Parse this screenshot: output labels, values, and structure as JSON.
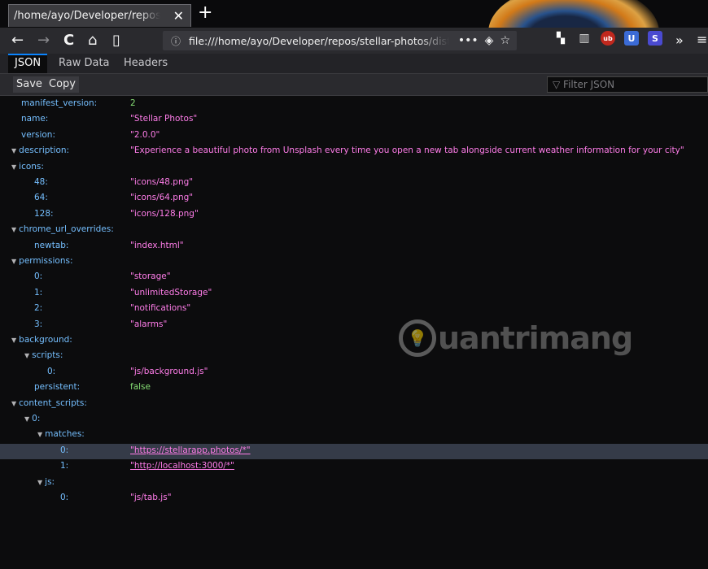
{
  "browser": {
    "tab": {
      "title": "/home/ayo/Developer/repos/stellar-photos/dist/manifest.json",
      "close": "✕"
    },
    "new_tab": "+",
    "nav": {
      "back": "←",
      "forward": "→",
      "reload": "C",
      "home": "⌂",
      "reader": "▯"
    },
    "url": {
      "info": "ⓘ",
      "text": "file:///home/ayo/Developer/repos/stellar-photos/dist/manifest.json",
      "more": "•••",
      "pocket": "◈",
      "star": "☆"
    },
    "extensions": [
      {
        "name": "library",
        "label": "▥"
      },
      {
        "name": "ublock",
        "label": "ub"
      },
      {
        "name": "shield",
        "label": "U"
      },
      {
        "name": "s-ext",
        "label": "S"
      }
    ],
    "overflow": "»",
    "menu": "≡"
  },
  "viewer": {
    "tabs": [
      "JSON",
      "Raw Data",
      "Headers"
    ],
    "toolbar": {
      "save": "Save",
      "copy": "Copy",
      "filter_placeholder": "▽ Filter JSON"
    }
  },
  "json_rows": [
    {
      "key": "manifest_version:",
      "value": "2",
      "type": "num",
      "indent": 0,
      "twisty": false
    },
    {
      "key": "name:",
      "value": "\"Stellar Photos\"",
      "type": "str",
      "indent": 0,
      "twisty": false
    },
    {
      "key": "version:",
      "value": "\"2.0.0\"",
      "type": "str",
      "indent": 0,
      "twisty": false
    },
    {
      "key": "description:",
      "value": "\"Experience a beautiful photo from Unsplash every time you open a new tab alongside current weather information for your city\"",
      "type": "str",
      "indent": 0,
      "twisty": true
    },
    {
      "key": "icons:",
      "value": "",
      "type": "obj",
      "indent": 0,
      "twisty": true
    },
    {
      "key": "48:",
      "value": "\"icons/48.png\"",
      "type": "str",
      "indent": 1,
      "twisty": false
    },
    {
      "key": "64:",
      "value": "\"icons/64.png\"",
      "type": "str",
      "indent": 1,
      "twisty": false
    },
    {
      "key": "128:",
      "value": "\"icons/128.png\"",
      "type": "str",
      "indent": 1,
      "twisty": false
    },
    {
      "key": "chrome_url_overrides:",
      "value": "",
      "type": "obj",
      "indent": 0,
      "twisty": true
    },
    {
      "key": "newtab:",
      "value": "\"index.html\"",
      "type": "str",
      "indent": 1,
      "twisty": false
    },
    {
      "key": "permissions:",
      "value": "",
      "type": "obj",
      "indent": 0,
      "twisty": true
    },
    {
      "key": "0:",
      "value": "\"storage\"",
      "type": "str",
      "indent": 1,
      "twisty": false
    },
    {
      "key": "1:",
      "value": "\"unlimitedStorage\"",
      "type": "str",
      "indent": 1,
      "twisty": false
    },
    {
      "key": "2:",
      "value": "\"notifications\"",
      "type": "str",
      "indent": 1,
      "twisty": false
    },
    {
      "key": "3:",
      "value": "\"alarms\"",
      "type": "str",
      "indent": 1,
      "twisty": false
    },
    {
      "key": "background:",
      "value": "",
      "type": "obj",
      "indent": 0,
      "twisty": true
    },
    {
      "key": "scripts:",
      "value": "",
      "type": "obj",
      "indent": 1,
      "twisty": true
    },
    {
      "key": "0:",
      "value": "\"js/background.js\"",
      "type": "str",
      "indent": 2,
      "twisty": false
    },
    {
      "key": "persistent:",
      "value": "false",
      "type": "bool",
      "indent": 1,
      "twisty": false
    },
    {
      "key": "content_scripts:",
      "value": "",
      "type": "obj",
      "indent": 0,
      "twisty": true
    },
    {
      "key": "0:",
      "value": "",
      "type": "obj",
      "indent": 1,
      "twisty": true
    },
    {
      "key": "matches:",
      "value": "",
      "type": "obj",
      "indent": 2,
      "twisty": true
    },
    {
      "key": "0:",
      "value": "\"https://stellarapp.photos/*\"",
      "type": "link",
      "indent": 3,
      "twisty": false,
      "selected": true
    },
    {
      "key": "1:",
      "value": "\"http://localhost:3000/*\"",
      "type": "link",
      "indent": 3,
      "twisty": false
    },
    {
      "key": "js:",
      "value": "",
      "type": "obj",
      "indent": 2,
      "twisty": true
    },
    {
      "key": "0:",
      "value": "\"js/tab.js\"",
      "type": "str",
      "indent": 3,
      "twisty": false
    }
  ],
  "watermark": {
    "icon": "💡",
    "text": "uantrimang"
  }
}
